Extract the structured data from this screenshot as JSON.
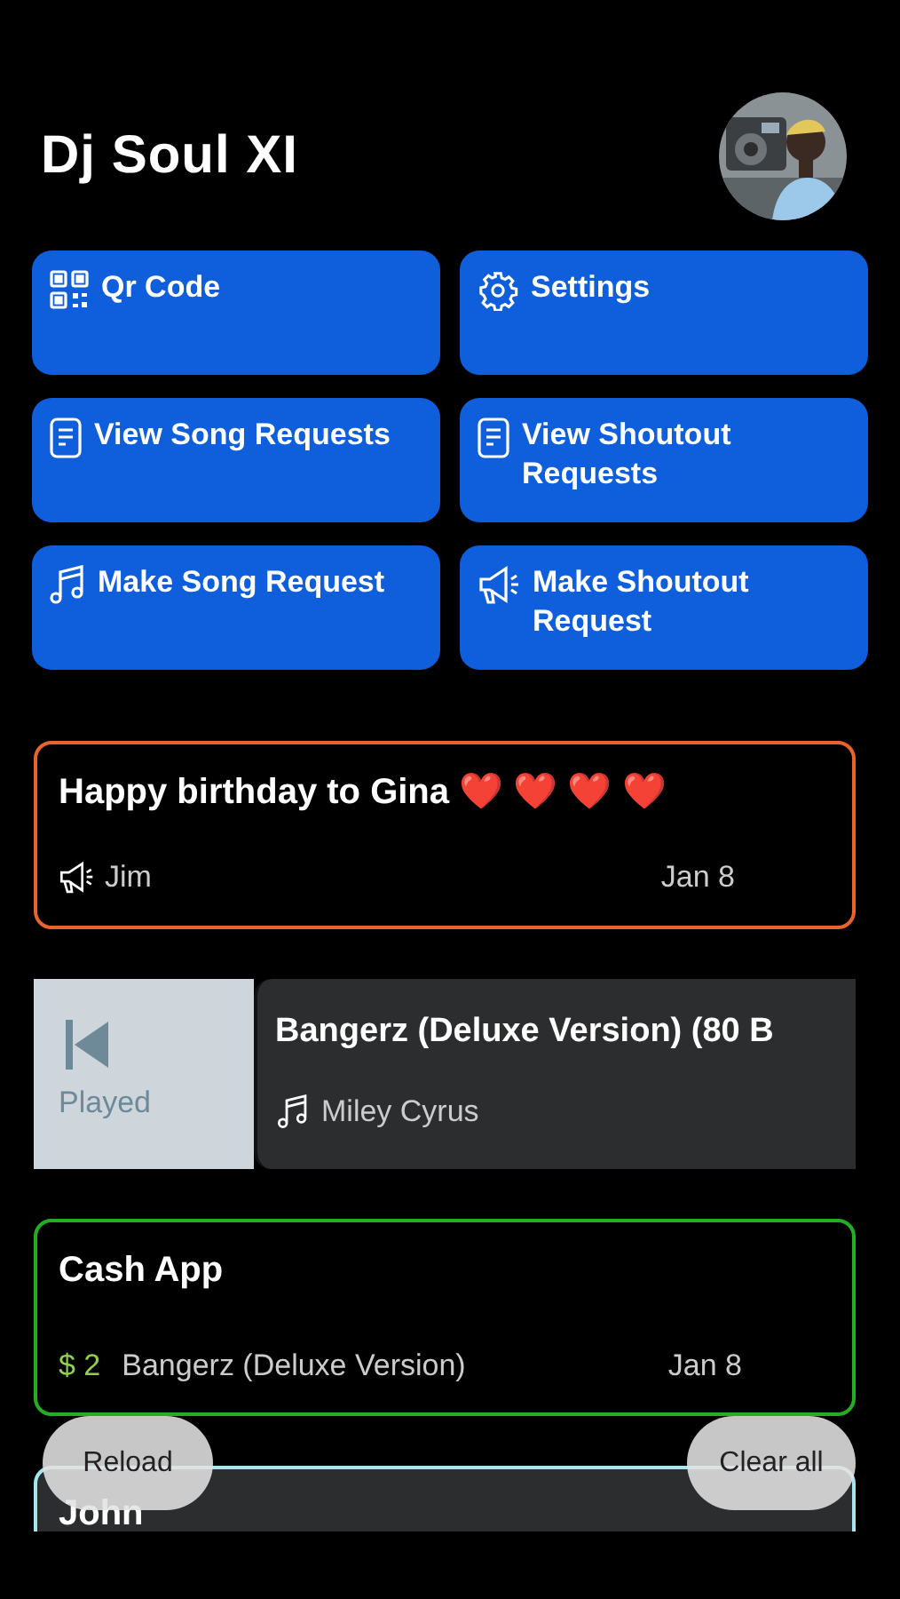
{
  "header": {
    "title": "Dj Soul XI"
  },
  "actions": [
    {
      "label": "Qr Code",
      "kind": "qr"
    },
    {
      "label": "Settings",
      "kind": "gear"
    },
    {
      "label": "View Song Requests",
      "kind": "document"
    },
    {
      "label": "View Shoutout Requests",
      "kind": "document"
    },
    {
      "label": "Make Song Request",
      "kind": "music"
    },
    {
      "label": "Make Shoutout Request",
      "kind": "megaphone"
    }
  ],
  "feed": [
    {
      "kind": "shoutout",
      "color": "#e8642c",
      "message": "Happy birthday to Gina ❤️ ❤️ ❤️ ❤️",
      "sender": "Jim",
      "date": "Jan 8"
    },
    {
      "kind": "song",
      "title": "Bangerz (Deluxe Version) (80 B",
      "artist": "Miley Cyrus",
      "swipe_action": "Played"
    },
    {
      "kind": "payment",
      "color": "#22b022",
      "title": "Cash App",
      "amount": "$ 2",
      "song": "Bangerz (Deluxe Version)",
      "date": "Jan 8"
    },
    {
      "kind": "partial",
      "color": "#a6e4ee",
      "title": "John"
    }
  ],
  "floating_buttons": [
    "Reload",
    "Clear all"
  ]
}
